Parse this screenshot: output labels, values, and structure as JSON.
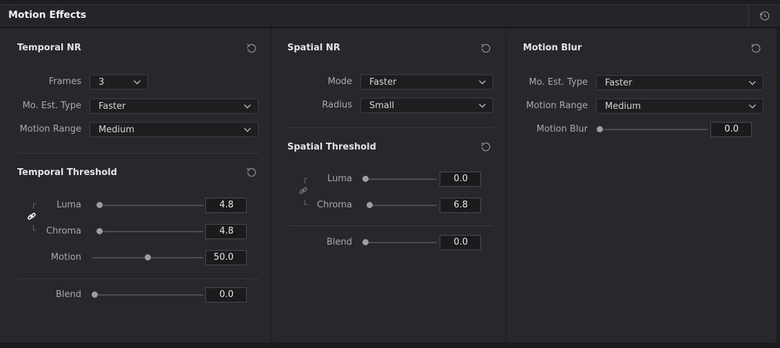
{
  "header": {
    "title": "Motion Effects",
    "reset_icon": "reset-history-icon"
  },
  "temporal_nr": {
    "title": "Temporal NR",
    "frames": {
      "label": "Frames",
      "value": "3"
    },
    "mo_est_type": {
      "label": "Mo. Est. Type",
      "value": "Faster"
    },
    "motion_range": {
      "label": "Motion Range",
      "value": "Medium"
    }
  },
  "temporal_threshold": {
    "title": "Temporal Threshold",
    "luma": {
      "label": "Luma",
      "value": "4.8"
    },
    "chroma": {
      "label": "Chroma",
      "value": "4.8"
    },
    "motion": {
      "label": "Motion",
      "value": "50.0"
    },
    "blend": {
      "label": "Blend",
      "value": "0.0"
    },
    "link_icon": "link-icon",
    "linked": true
  },
  "spatial_nr": {
    "title": "Spatial NR",
    "mode": {
      "label": "Mode",
      "value": "Faster"
    },
    "radius": {
      "label": "Radius",
      "value": "Small"
    }
  },
  "spatial_threshold": {
    "title": "Spatial Threshold",
    "luma": {
      "label": "Luma",
      "value": "0.0"
    },
    "chroma": {
      "label": "Chroma",
      "value": "6.8"
    },
    "blend": {
      "label": "Blend",
      "value": "0.0"
    },
    "link_icon": "link-icon",
    "linked": false
  },
  "motion_blur": {
    "title": "Motion Blur",
    "mo_est_type": {
      "label": "Mo. Est. Type",
      "value": "Faster"
    },
    "motion_range": {
      "label": "Motion Range",
      "value": "Medium"
    },
    "motion_blur": {
      "label": "Motion Blur",
      "value": "0.0"
    }
  },
  "colors": {
    "background": "#1d1d21",
    "panel": "#28282c",
    "header": "#252529",
    "field": "#1e1e21",
    "slider_thumb": "#9d9da2"
  }
}
